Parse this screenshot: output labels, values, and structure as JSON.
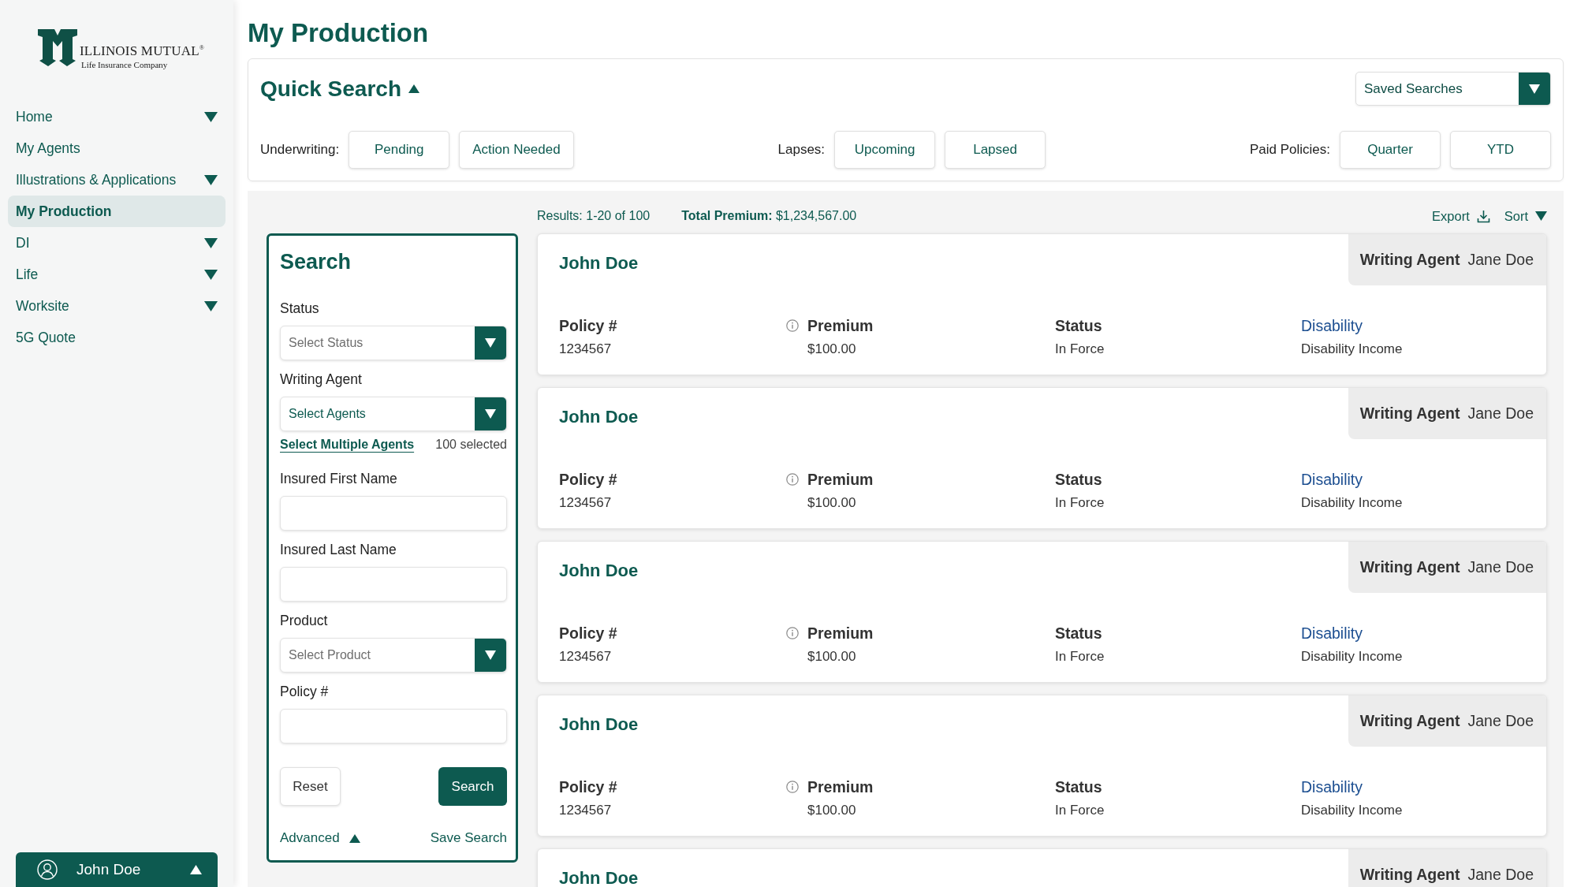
{
  "sidebar": {
    "logo": {
      "name": "ILLINOIS MUTUAL$^{®}$",
      "tagline": "Life Insurance Company"
    },
    "nav": [
      {
        "label": "Home",
        "selected": false,
        "submenu": true
      },
      {
        "label": "My Agents",
        "selected": false,
        "submenu": false
      },
      {
        "label": "Illustrations & Applications",
        "selected": false,
        "submenu": true
      },
      {
        "label": "My Production",
        "selected": true,
        "submenu": false
      },
      {
        "label": "DI",
        "selected": false,
        "submenu": true
      },
      {
        "label": "Life",
        "selected": false,
        "submenu": true
      },
      {
        "label": "Worksite",
        "selected": false,
        "submenu": true
      },
      {
        "label": "5G Quote",
        "selected": false,
        "submenu": false
      }
    ],
    "user": {
      "name": "John Doe"
    }
  },
  "page_title": "My Production",
  "quick_search": {
    "title": "Quick Search",
    "saved_searches": "Saved Searches",
    "groups": [
      {
        "label": "Underwriting:",
        "buttons": [
          "Pending",
          "Action Needed"
        ]
      },
      {
        "label": "Lapses:",
        "buttons": [
          "Upcoming",
          "Lapsed"
        ]
      },
      {
        "label": "Paid Policies:",
        "buttons": [
          "Quarter",
          "YTD"
        ]
      }
    ]
  },
  "search": {
    "title": "Search",
    "fields": [
      {
        "kind": "select",
        "label": "Status",
        "placeholder": "Select Status"
      },
      {
        "kind": "select",
        "label": "Writing Agent",
        "value": "Select Agents",
        "link": "Select Multiple Agents",
        "note": "100 selected"
      },
      {
        "kind": "text",
        "label": "Insured First Name"
      },
      {
        "kind": "text",
        "label": "Insured Last Name"
      },
      {
        "kind": "select",
        "label": "Product",
        "placeholder": "Select Product"
      },
      {
        "kind": "text",
        "label": "Policy #"
      }
    ],
    "reset": "Reset",
    "submit": "Search",
    "advanced": "Advanced",
    "save": "Save Search"
  },
  "results": {
    "summary": "Results: 1-20 of 100",
    "total_premium": "**Total Premium:** $1,234,567.00",
    "export": "Export",
    "sort": "Sort",
    "cards": [
      {
        "name": "John Doe",
        "agent_label": "Writing Agent",
        "agent": "Jane Doe",
        "fields": [
          {
            "kind": "text",
            "label": "Policy #",
            "value": "1234567"
          },
          {
            "kind": "info",
            "label": "Premium",
            "value": "$100.00"
          },
          {
            "kind": "text",
            "label": "Status",
            "value": "In Force"
          },
          {
            "kind": "link",
            "label": "Disability",
            "value": "Disability Income"
          }
        ]
      },
      {
        "name": "John Doe",
        "agent_label": "Writing Agent",
        "agent": "Jane Doe",
        "fields": [
          {
            "kind": "text",
            "label": "Policy #",
            "value": "1234567"
          },
          {
            "kind": "info",
            "label": "Premium",
            "value": "$100.00"
          },
          {
            "kind": "text",
            "label": "Status",
            "value": "In Force"
          },
          {
            "kind": "link",
            "label": "Disability",
            "value": "Disability Income"
          }
        ]
      },
      {
        "name": "John Doe",
        "agent_label": "Writing Agent",
        "agent": "Jane Doe",
        "fields": [
          {
            "kind": "text",
            "label": "Policy #",
            "value": "1234567"
          },
          {
            "kind": "info",
            "label": "Premium",
            "value": "$100.00"
          },
          {
            "kind": "text",
            "label": "Status",
            "value": "In Force"
          },
          {
            "kind": "link",
            "label": "Disability",
            "value": "Disability Income"
          }
        ]
      },
      {
        "name": "John Doe",
        "agent_label": "Writing Agent",
        "agent": "Jane Doe",
        "fields": [
          {
            "kind": "text",
            "label": "Policy #",
            "value": "1234567"
          },
          {
            "kind": "info",
            "label": "Premium",
            "value": "$100.00"
          },
          {
            "kind": "text",
            "label": "Status",
            "value": "In Force"
          },
          {
            "kind": "link",
            "label": "Disability",
            "value": "Disability Income"
          }
        ]
      },
      {
        "name": "John Doe",
        "agent_label": "Writing Agent",
        "agent": "Jane Doe"
      }
    ]
  }
}
